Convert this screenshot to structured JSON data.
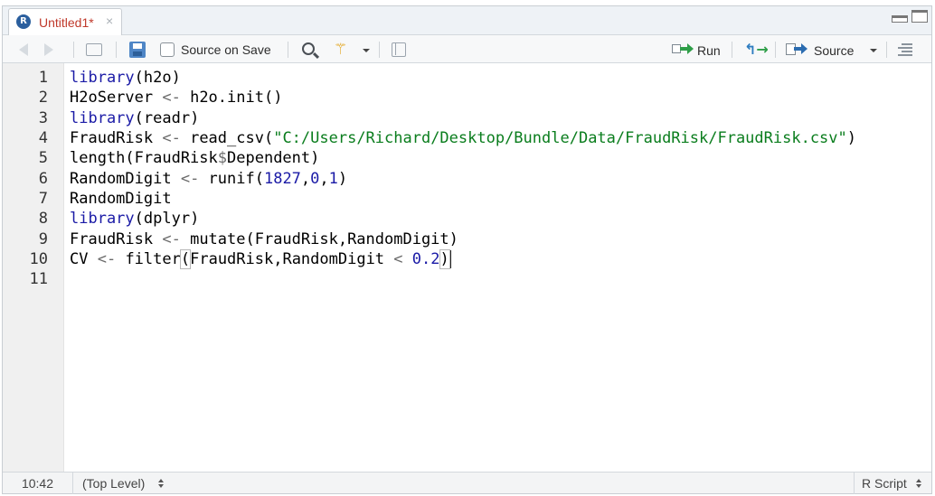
{
  "tab": {
    "title": "Untitled1*",
    "icon": "r-script-icon",
    "close_glyph": "×"
  },
  "toolbar": {
    "source_on_save_label": "Source on Save",
    "source_on_save_checked": false,
    "run_label": "Run",
    "source_label": "Source"
  },
  "editor": {
    "line_numbers": [
      "1",
      "2",
      "3",
      "4",
      "5",
      "6",
      "7",
      "8",
      "9",
      "10",
      "11"
    ],
    "lines": [
      "library(h2o)",
      "H2oServer <- h2o.init()",
      "library(readr)",
      "FraudRisk <- read_csv(\"C:/Users/Richard/Desktop/Bundle/Data/FraudRisk/FraudRisk.csv\")",
      "length(FraudRisk$Dependent)",
      "RandomDigit <- runif(1827,0,1)",
      "RandomDigit",
      "library(dplyr)",
      "FraudRisk <- mutate(FraudRisk,RandomDigit)",
      "CV <- filter(FraudRisk,RandomDigit < 0.2)",
      ""
    ],
    "tokens": {
      "l1": [
        "library",
        "(h2o)"
      ],
      "l2": [
        "H2oServer ",
        "<-",
        " h2o.init()"
      ],
      "l3": [
        "library",
        "(readr)"
      ],
      "l4": [
        "FraudRisk ",
        "<-",
        " read_csv(",
        "\"C:/Users/Richard/Desktop/Bundle/Data/FraudRisk/FraudRisk.csv\"",
        ")"
      ],
      "l5": [
        "length(FraudRisk",
        "$",
        "Dependent)"
      ],
      "l6": [
        "RandomDigit ",
        "<-",
        " runif(",
        "1827",
        ",",
        "0",
        ",",
        "1",
        ")"
      ],
      "l7": [
        "RandomDigit"
      ],
      "l8": [
        "library",
        "(dplyr)"
      ],
      "l9": [
        "FraudRisk ",
        "<-",
        " mutate(FraudRisk,RandomDigit)"
      ],
      "l10": [
        "CV ",
        "<-",
        " filter",
        "(",
        "FraudRisk,RandomDigit ",
        "<",
        " ",
        "0.2",
        ")"
      ]
    }
  },
  "status": {
    "cursor_position": "10:42",
    "scope": "(Top Level)",
    "language": "R Script"
  },
  "colors": {
    "keyword": "#1a1aa6",
    "string": "#0a7d1d",
    "number": "#1a1aa6",
    "operator": "#6a6a6a",
    "tab_title": "#c0392b"
  }
}
